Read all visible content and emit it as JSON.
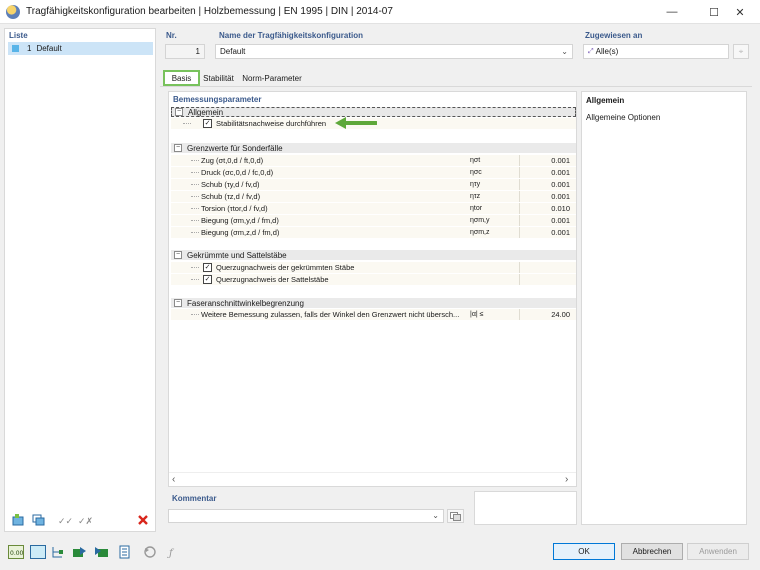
{
  "window": {
    "title": "Tragfähigkeitskonfiguration bearbeiten | Holzbemessung | EN 1995 | DIN | 2014-07",
    "minimize": "—",
    "maximize": "☐",
    "close": "✕"
  },
  "list": {
    "header": "Liste",
    "items": [
      {
        "number": "1",
        "name": "Default",
        "color": "#58b4e8"
      }
    ]
  },
  "fields": {
    "nr_label": "Nr.",
    "nr_value": "1",
    "name_label": "Name der Tragfähigkeitskonfiguration",
    "name_value": "Default",
    "assigned_label": "Zugewiesen an",
    "assigned_value": "Alle(s)"
  },
  "tabs": [
    {
      "label": "Basis",
      "active": true
    },
    {
      "label": "Stabilität",
      "active": false
    },
    {
      "label": "Norm-Parameter",
      "active": false
    }
  ],
  "grid": {
    "section_title": "Bemessungsparameter",
    "groups": [
      {
        "title": "Allgemein",
        "rows": [
          {
            "label": "Stabilitätsnachweise durchführen",
            "checked": true
          }
        ]
      },
      {
        "title": "Grenzwerte für Sonderfälle",
        "rows": [
          {
            "label": "Zug (σt,0,d / ft,0,d)",
            "symbol": "ησt",
            "value": "0.001"
          },
          {
            "label": "Druck (σc,0,d / fc,0,d)",
            "symbol": "ησc",
            "value": "0.001"
          },
          {
            "label": "Schub (τy,d / fv,d)",
            "symbol": "ητy",
            "value": "0.001"
          },
          {
            "label": "Schub (τz,d / fv,d)",
            "symbol": "ητz",
            "value": "0.001"
          },
          {
            "label": "Torsion (τtor,d / fv,d)",
            "symbol": "ηtor",
            "value": "0.010"
          },
          {
            "label": "Biegung (σm,y,d / fm,d)",
            "symbol": "ησm,y",
            "value": "0.001"
          },
          {
            "label": "Biegung (σm,z,d / fm,d)",
            "symbol": "ησm,z",
            "value": "0.001"
          }
        ]
      },
      {
        "title": "Gekrümmte und Sattelstäbe",
        "rows": [
          {
            "label": "Querzugnachweis der gekrümmten Stäbe",
            "checked": true
          },
          {
            "label": "Querzugnachweis der Sattelstäbe",
            "checked": true
          }
        ]
      },
      {
        "title": "Faseranschnittwinkelbegrenzung",
        "rows": [
          {
            "label": "Weitere Bemessung zulassen, falls der Winkel den Grenzwert nicht übersch...",
            "symbol": "|α| ≤",
            "value": "24.00"
          }
        ]
      }
    ],
    "check_glyph": "✓",
    "scroll_left": "‹",
    "scroll_right": "›"
  },
  "info": {
    "title": "Allgemein",
    "text": "Allgemeine Optionen"
  },
  "comment": {
    "label": "Kommentar",
    "value": ""
  },
  "buttons": {
    "ok": "OK",
    "cancel": "Abbrechen",
    "apply": "Anwenden"
  },
  "bottom_icons": {
    "units": "0.00"
  },
  "colors": {
    "accent_green": "#5ea83a",
    "header_blue": "#3b5a8c",
    "selection": "#cce4f7",
    "delete_red": "#d9261c"
  }
}
